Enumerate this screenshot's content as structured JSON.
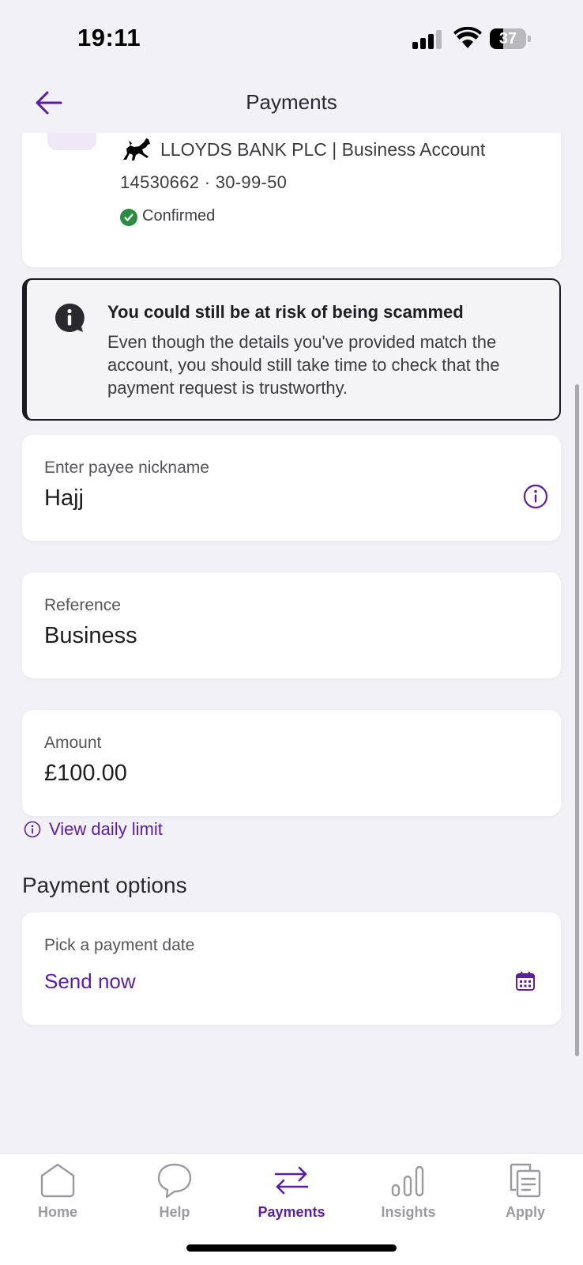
{
  "status_bar": {
    "time": "19:11",
    "battery": "37",
    "battery_level": 0.37
  },
  "header": {
    "title": "Payments",
    "back_icon": "arrow-left-icon"
  },
  "payee": {
    "bank_name": "LLOYDS BANK PLC | Business Account",
    "account_details": "14530662 · 30-99-50",
    "status": "Confirmed",
    "logo_icon": "black-horse-icon"
  },
  "warning": {
    "title": "You could still be at risk of being scammed",
    "text": "Even though the details you've provided match the account, you should still take time to check that the payment request is trustworthy."
  },
  "form": {
    "nickname_label": "Enter payee nickname",
    "nickname_value": "Hajj",
    "reference_label": "Reference",
    "reference_value": "Business",
    "amount_label": "Amount",
    "amount_value": "£100.00",
    "daily_limit_label": "View daily limit"
  },
  "payment_options": {
    "title": "Payment options",
    "date_label": "Pick a payment date",
    "date_value": "Send now"
  },
  "nav": {
    "items": [
      {
        "label": "Home",
        "icon": "home-icon"
      },
      {
        "label": "Help",
        "icon": "help-bubble-icon"
      },
      {
        "label": "Payments",
        "icon": "transfer-arrows-icon",
        "active": true
      },
      {
        "label": "Insights",
        "icon": "insights-icon"
      },
      {
        "label": "Apply",
        "icon": "apply-documents-icon"
      }
    ]
  },
  "colors": {
    "accent": "#5a1fa0",
    "background": "#f2f1f6",
    "success": "#2e8b43"
  }
}
